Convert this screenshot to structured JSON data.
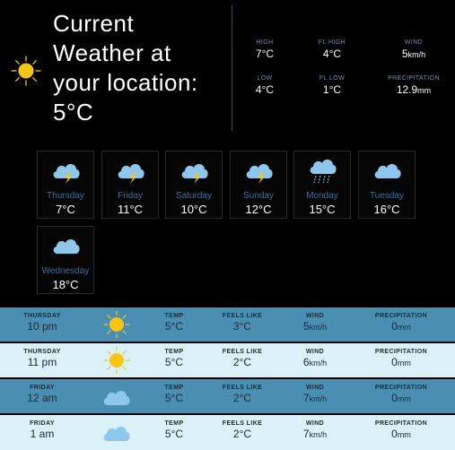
{
  "current": {
    "title_line1": "Current",
    "title_line2": "Weather at",
    "title_line3": "your location:",
    "temperature": "5°C",
    "icon": "sun-icon"
  },
  "stats": [
    {
      "label": "HIGH",
      "value": "7°C",
      "unit": ""
    },
    {
      "label": "FL HIGH",
      "value": "4°C",
      "unit": ""
    },
    {
      "label": "WIND",
      "value": "5",
      "unit": "km/h"
    },
    {
      "label": "LOW",
      "value": "4°C",
      "unit": ""
    },
    {
      "label": "FL LOW",
      "value": "1°C",
      "unit": ""
    },
    {
      "label": "PRECIPITATION",
      "value": "12.9",
      "unit": "mm"
    }
  ],
  "forecast": [
    {
      "day": "Thursday",
      "temp": "7°C",
      "icon": "thunder-cloud-icon"
    },
    {
      "day": "Friday",
      "temp": "11°C",
      "icon": "thunder-cloud-icon"
    },
    {
      "day": "Saturday",
      "temp": "10°C",
      "icon": "thunder-cloud-icon"
    },
    {
      "day": "Sunday",
      "temp": "12°C",
      "icon": "thunder-cloud-icon"
    },
    {
      "day": "Monday",
      "temp": "15°C",
      "icon": "rain-cloud-icon"
    },
    {
      "day": "Tuesday",
      "temp": "16°C",
      "icon": "cloud-icon"
    },
    {
      "day": "Wednesday",
      "temp": "18°C",
      "icon": "cloud-icon"
    }
  ],
  "hourly_headers": {
    "temp": "TEMP",
    "feels": "FEELS LIKE",
    "wind": "WIND",
    "precip": "PRECIPITATION"
  },
  "hourly": [
    {
      "day": "THURSDAY",
      "time": "10 pm",
      "icon": "sun-icon",
      "temp": "5°C",
      "feels": "3°C",
      "wind": "5",
      "wind_unit": "km/h",
      "precip": "0",
      "precip_unit": "mm"
    },
    {
      "day": "THURSDAY",
      "time": "11 pm",
      "icon": "sun-icon",
      "temp": "5°C",
      "feels": "2°C",
      "wind": "6",
      "wind_unit": "km/h",
      "precip": "0",
      "precip_unit": "mm"
    },
    {
      "day": "FRIDAY",
      "time": "12 am",
      "icon": "cloud-icon",
      "temp": "5°C",
      "feels": "2°C",
      "wind": "7",
      "wind_unit": "km/h",
      "precip": "0",
      "precip_unit": "mm"
    },
    {
      "day": "FRIDAY",
      "time": "1 am",
      "icon": "cloud-icon",
      "temp": "5°C",
      "feels": "2°C",
      "wind": "7",
      "wind_unit": "km/h",
      "precip": "0",
      "precip_unit": "mm"
    }
  ],
  "colors": {
    "background": "#000000",
    "tile_label": "#3f6f96",
    "stat_label": "#6f92ad",
    "row_dark": "#4a8fb2",
    "row_light": "#d9f1f7",
    "sun": "#f5c518",
    "cloud": "#8fc7ec"
  }
}
